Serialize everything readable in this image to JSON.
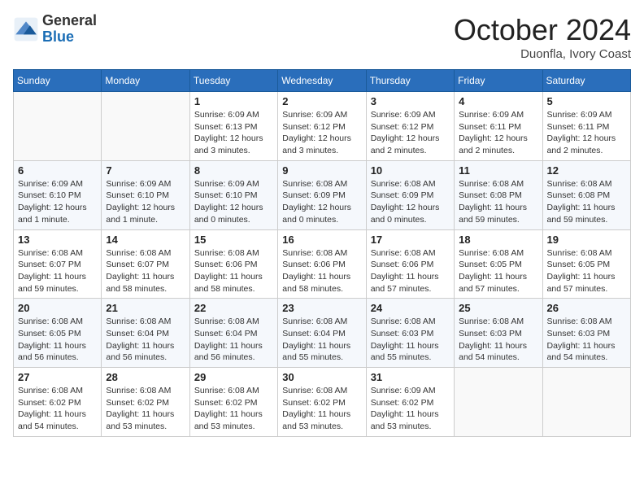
{
  "header": {
    "logo_general": "General",
    "logo_blue": "Blue",
    "month_title": "October 2024",
    "subtitle": "Duonfla, Ivory Coast"
  },
  "days_of_week": [
    "Sunday",
    "Monday",
    "Tuesday",
    "Wednesday",
    "Thursday",
    "Friday",
    "Saturday"
  ],
  "weeks": [
    [
      {
        "day": "",
        "info": ""
      },
      {
        "day": "",
        "info": ""
      },
      {
        "day": "1",
        "info": "Sunrise: 6:09 AM\nSunset: 6:13 PM\nDaylight: 12 hours and 3 minutes."
      },
      {
        "day": "2",
        "info": "Sunrise: 6:09 AM\nSunset: 6:12 PM\nDaylight: 12 hours and 3 minutes."
      },
      {
        "day": "3",
        "info": "Sunrise: 6:09 AM\nSunset: 6:12 PM\nDaylight: 12 hours and 2 minutes."
      },
      {
        "day": "4",
        "info": "Sunrise: 6:09 AM\nSunset: 6:11 PM\nDaylight: 12 hours and 2 minutes."
      },
      {
        "day": "5",
        "info": "Sunrise: 6:09 AM\nSunset: 6:11 PM\nDaylight: 12 hours and 2 minutes."
      }
    ],
    [
      {
        "day": "6",
        "info": "Sunrise: 6:09 AM\nSunset: 6:10 PM\nDaylight: 12 hours and 1 minute."
      },
      {
        "day": "7",
        "info": "Sunrise: 6:09 AM\nSunset: 6:10 PM\nDaylight: 12 hours and 1 minute."
      },
      {
        "day": "8",
        "info": "Sunrise: 6:09 AM\nSunset: 6:10 PM\nDaylight: 12 hours and 0 minutes."
      },
      {
        "day": "9",
        "info": "Sunrise: 6:08 AM\nSunset: 6:09 PM\nDaylight: 12 hours and 0 minutes."
      },
      {
        "day": "10",
        "info": "Sunrise: 6:08 AM\nSunset: 6:09 PM\nDaylight: 12 hours and 0 minutes."
      },
      {
        "day": "11",
        "info": "Sunrise: 6:08 AM\nSunset: 6:08 PM\nDaylight: 11 hours and 59 minutes."
      },
      {
        "day": "12",
        "info": "Sunrise: 6:08 AM\nSunset: 6:08 PM\nDaylight: 11 hours and 59 minutes."
      }
    ],
    [
      {
        "day": "13",
        "info": "Sunrise: 6:08 AM\nSunset: 6:07 PM\nDaylight: 11 hours and 59 minutes."
      },
      {
        "day": "14",
        "info": "Sunrise: 6:08 AM\nSunset: 6:07 PM\nDaylight: 11 hours and 58 minutes."
      },
      {
        "day": "15",
        "info": "Sunrise: 6:08 AM\nSunset: 6:06 PM\nDaylight: 11 hours and 58 minutes."
      },
      {
        "day": "16",
        "info": "Sunrise: 6:08 AM\nSunset: 6:06 PM\nDaylight: 11 hours and 58 minutes."
      },
      {
        "day": "17",
        "info": "Sunrise: 6:08 AM\nSunset: 6:06 PM\nDaylight: 11 hours and 57 minutes."
      },
      {
        "day": "18",
        "info": "Sunrise: 6:08 AM\nSunset: 6:05 PM\nDaylight: 11 hours and 57 minutes."
      },
      {
        "day": "19",
        "info": "Sunrise: 6:08 AM\nSunset: 6:05 PM\nDaylight: 11 hours and 57 minutes."
      }
    ],
    [
      {
        "day": "20",
        "info": "Sunrise: 6:08 AM\nSunset: 6:05 PM\nDaylight: 11 hours and 56 minutes."
      },
      {
        "day": "21",
        "info": "Sunrise: 6:08 AM\nSunset: 6:04 PM\nDaylight: 11 hours and 56 minutes."
      },
      {
        "day": "22",
        "info": "Sunrise: 6:08 AM\nSunset: 6:04 PM\nDaylight: 11 hours and 56 minutes."
      },
      {
        "day": "23",
        "info": "Sunrise: 6:08 AM\nSunset: 6:04 PM\nDaylight: 11 hours and 55 minutes."
      },
      {
        "day": "24",
        "info": "Sunrise: 6:08 AM\nSunset: 6:03 PM\nDaylight: 11 hours and 55 minutes."
      },
      {
        "day": "25",
        "info": "Sunrise: 6:08 AM\nSunset: 6:03 PM\nDaylight: 11 hours and 54 minutes."
      },
      {
        "day": "26",
        "info": "Sunrise: 6:08 AM\nSunset: 6:03 PM\nDaylight: 11 hours and 54 minutes."
      }
    ],
    [
      {
        "day": "27",
        "info": "Sunrise: 6:08 AM\nSunset: 6:02 PM\nDaylight: 11 hours and 54 minutes."
      },
      {
        "day": "28",
        "info": "Sunrise: 6:08 AM\nSunset: 6:02 PM\nDaylight: 11 hours and 53 minutes."
      },
      {
        "day": "29",
        "info": "Sunrise: 6:08 AM\nSunset: 6:02 PM\nDaylight: 11 hours and 53 minutes."
      },
      {
        "day": "30",
        "info": "Sunrise: 6:08 AM\nSunset: 6:02 PM\nDaylight: 11 hours and 53 minutes."
      },
      {
        "day": "31",
        "info": "Sunrise: 6:09 AM\nSunset: 6:02 PM\nDaylight: 11 hours and 53 minutes."
      },
      {
        "day": "",
        "info": ""
      },
      {
        "day": "",
        "info": ""
      }
    ]
  ]
}
